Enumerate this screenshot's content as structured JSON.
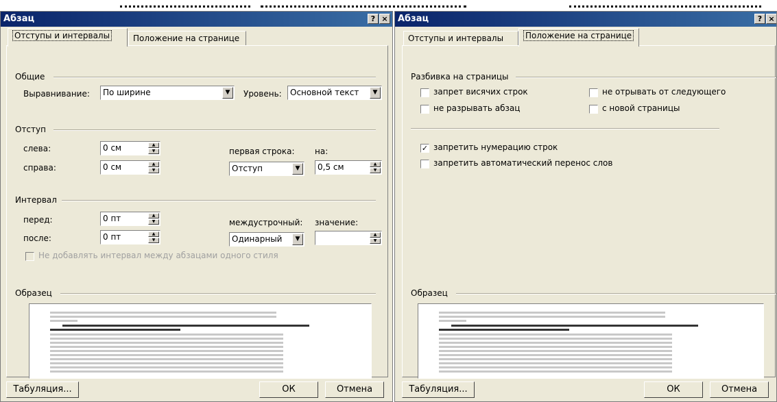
{
  "left_dialog": {
    "title": "Абзац",
    "help_button": "?",
    "close_button": "×",
    "tabs": [
      "Отступы и интервалы",
      "Положение на странице"
    ],
    "active_tab": 0,
    "general": {
      "group_label": "Общие",
      "alignment_label": "Выравнивание:",
      "alignment_value": "По ширине",
      "level_label": "Уровень:",
      "level_value": "Основной текст"
    },
    "indent": {
      "group_label": "Отступ",
      "left_label": "слева:",
      "left_value": "0 см",
      "right_label": "справа:",
      "right_value": "0 см",
      "first_line_label": "первая строка:",
      "first_line_value": "Отступ",
      "by_label": "на:",
      "by_value": "0,5 см"
    },
    "spacing": {
      "group_label": "Интервал",
      "before_label": "перед:",
      "before_value": "0 пт",
      "after_label": "после:",
      "after_value": "0 пт",
      "line_spacing_label": "междустрочный:",
      "line_spacing_value": "Одинарный",
      "at_label": "значение:",
      "at_value": "",
      "no_space_label": "Не добавлять интервал между абзацами одного стиля"
    },
    "preview": {
      "group_label": "Образец"
    },
    "buttons": {
      "tabs": "Табуляция...",
      "ok": "ОК",
      "cancel": "Отмена"
    }
  },
  "right_dialog": {
    "title": "Абзац",
    "help_button": "?",
    "close_button": "×",
    "tabs": [
      "Отступы и интервалы",
      "Положение на странице"
    ],
    "active_tab": 1,
    "pagination": {
      "group_label": "Разбивка на страницы",
      "widow_control": {
        "label": "запрет висячих строк",
        "checked": false
      },
      "keep_with_next": {
        "label": "не отрывать от следующего",
        "checked": false
      },
      "keep_lines_together": {
        "label": "не разрывать абзац",
        "checked": false
      },
      "page_break_before": {
        "label": "с новой страницы",
        "checked": false
      }
    },
    "suppress_line_numbers": {
      "label": "запретить нумерацию строк",
      "checked": true
    },
    "no_hyphenation": {
      "label": "запретить автоматический перенос слов",
      "checked": false
    },
    "preview": {
      "group_label": "Образец"
    },
    "buttons": {
      "tabs": "Табуляция...",
      "ok": "ОК",
      "cancel": "Отмена"
    }
  },
  "colors": {
    "dialog_bg": "#ECE9D8",
    "title_gradient_start": "#0a246a",
    "title_gradient_end": "#3a6ea5",
    "preview_grey_text": "#b0b0b0",
    "preview_main_text": "#000000"
  }
}
